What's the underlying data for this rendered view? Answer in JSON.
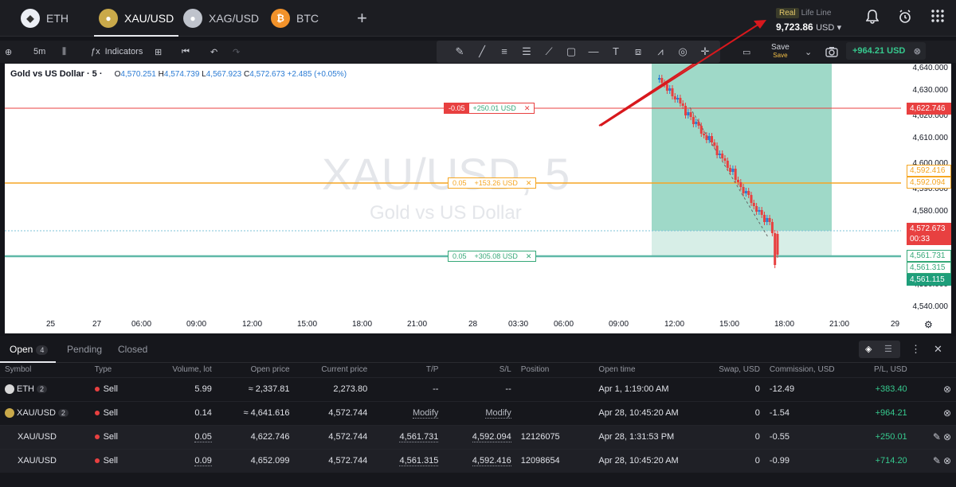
{
  "tabs": [
    {
      "label": "ETH",
      "icon": "ethereum-icon",
      "active": false
    },
    {
      "label": "XAU/USD",
      "icon": "gold-flag-icon",
      "active": true
    },
    {
      "label": "XAG/USD",
      "icon": "silver-flag-icon",
      "active": false
    },
    {
      "label": "BTC",
      "icon": "bitcoin-icon",
      "active": false
    }
  ],
  "account": {
    "type": "Real",
    "name": "Life Line",
    "balance": "9,723.86",
    "currency": "USD"
  },
  "toolbar": {
    "timeframe": "5m",
    "indicators": "Indicators",
    "save": "Save",
    "save_sub": "Save",
    "pl": "+964.21 USD"
  },
  "legend": {
    "title": "Gold vs US Dollar · 5 ·",
    "o": "4,570.251",
    "h": "4,574.739",
    "l": "4,567.923",
    "c": "4,572.673",
    "change": "+2.485 (+0.05%)"
  },
  "watermark": {
    "symbol": "XAU/USD, 5",
    "name": "Gold vs US Dollar"
  },
  "order_tags": {
    "tp1": {
      "lots": "-0.05",
      "pl": "+250.01 USD"
    },
    "tp2": {
      "lots": "0.05",
      "pl": "+153.26 USD"
    },
    "tp3": {
      "lots": "0.05",
      "pl": "+305.08 USD"
    }
  },
  "price_scale": [
    "4,640.000",
    "4,630.000",
    "4,620.000",
    "4,610.000",
    "4,600.000",
    "4,590.000",
    "4,580.000",
    "4,550.000",
    "4,540.000"
  ],
  "price_tags": {
    "p1": "4,622.746",
    "p2": "4,592.416",
    "p3": "4,592.094",
    "p4": "4,572.673",
    "p4_timer": "00:33",
    "p5": "4,561.731",
    "p6": "4,561.315",
    "p7": "4,561.115"
  },
  "time_scale": [
    "25",
    "27",
    "06:00",
    "09:00",
    "12:00",
    "15:00",
    "18:00",
    "21:00",
    "28",
    "03:30",
    "06:00",
    "09:00",
    "12:00",
    "15:00",
    "18:00",
    "21:00",
    "29"
  ],
  "panel": {
    "tabs": [
      {
        "label": "Open",
        "count": "4"
      },
      {
        "label": "Pending"
      },
      {
        "label": "Closed"
      }
    ],
    "columns": [
      "Symbol",
      "Type",
      "Volume, lot",
      "Open price",
      "Current price",
      "T/P",
      "S/L",
      "Position",
      "Open time",
      "Swap, USD",
      "Commission, USD",
      "P/L, USD"
    ],
    "rows": [
      {
        "symbol": "ETH",
        "badge": "2",
        "type": "Sell",
        "volume": "5.99",
        "open": "≈ 2,337.81",
        "current": "2,273.80",
        "tp": "--",
        "sl": "--",
        "position": "",
        "time": "Apr 1, 1:19:00 AM",
        "swap": "0",
        "commission": "-12.49",
        "pl": "+383.40"
      },
      {
        "symbol": "XAU/USD",
        "badge": "2",
        "type": "Sell",
        "volume": "0.14",
        "open": "≈ 4,641.616",
        "current": "4,572.744",
        "tp": "Modify",
        "sl": "Modify",
        "position": "",
        "time": "Apr 28, 10:45:20 AM",
        "swap": "0",
        "commission": "-1.54",
        "pl": "+964.21"
      },
      {
        "symbol": "XAU/USD",
        "badge": "",
        "type": "Sell",
        "volume": "0.05",
        "open": "4,622.746",
        "current": "4,572.744",
        "tp": "4,561.731",
        "sl": "4,592.094",
        "position": "12126075",
        "time": "Apr 28, 1:31:53 PM",
        "swap": "0",
        "commission": "-0.55",
        "pl": "+250.01"
      },
      {
        "symbol": "XAU/USD",
        "badge": "",
        "type": "Sell",
        "volume": "0.09",
        "open": "4,652.099",
        "current": "4,572.744",
        "tp": "4,561.315",
        "sl": "4,592.416",
        "position": "12098654",
        "time": "Apr 28, 10:45:20 AM",
        "swap": "0",
        "commission": "-0.99",
        "pl": "+714.20"
      }
    ]
  },
  "colors": {
    "profit": "#36c98e",
    "sell": "#e84040",
    "tp_zone": "#9fd9c8",
    "sl_line": "#f5a623",
    "open_line": "#e84040"
  }
}
